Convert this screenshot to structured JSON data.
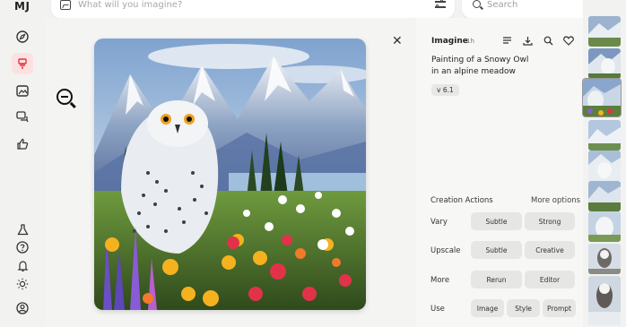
{
  "app": {
    "logo": "MJ"
  },
  "prompt_bar": {
    "placeholder": "What will you imagine?"
  },
  "search": {
    "placeholder": "Search"
  },
  "sidebar": {
    "items": [
      {
        "icon": "compass-icon",
        "label": "Explore"
      },
      {
        "icon": "brush-icon",
        "label": "Create",
        "active": true
      },
      {
        "icon": "image-icon",
        "label": "Organize"
      },
      {
        "icon": "chat-icon",
        "label": "Chat"
      },
      {
        "icon": "thumbs-up-icon",
        "label": "Rank"
      }
    ],
    "bottom_items": [
      {
        "icon": "flask-icon"
      },
      {
        "icon": "help-icon"
      },
      {
        "icon": "bell-icon"
      },
      {
        "icon": "sun-icon"
      },
      {
        "icon": "user-icon"
      }
    ]
  },
  "viewer": {
    "image_subject": "Snowy owl in an alpine meadow painting"
  },
  "panel": {
    "title": "Imagine",
    "time": "1h",
    "prompt_line1": "Painting of a Snowy Owl",
    "prompt_line2": "in an alpine meadow",
    "version": "v 6.1",
    "creation_actions_title": "Creation Actions",
    "more_options": "More options",
    "rows": [
      {
        "label": "Vary",
        "buttons": [
          "Subtle",
          "Strong"
        ]
      },
      {
        "label": "Upscale",
        "buttons": [
          "Subtle",
          "Creative"
        ]
      },
      {
        "label": "More",
        "buttons": [
          "Rerun",
          "Editor"
        ]
      },
      {
        "label": "Use",
        "buttons": [
          "Image",
          "Style",
          "Prompt"
        ]
      }
    ]
  },
  "colors": {
    "accent_active": "#e03434",
    "active_bg": "#fde1e1",
    "button_bg": "#e6e6e5"
  }
}
